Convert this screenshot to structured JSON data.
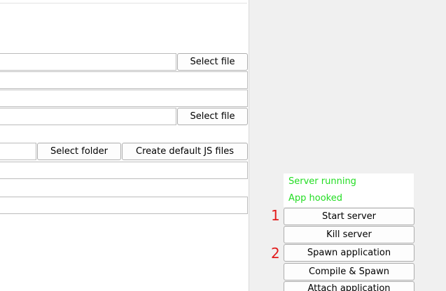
{
  "config": {
    "file_field_1": {
      "value": "",
      "button_label": "Select file"
    },
    "field_2": {
      "value": ""
    },
    "field_3": {
      "value": ""
    },
    "file_field_4": {
      "value": "",
      "button_label": "Select file"
    },
    "folder_field": {
      "value": "",
      "select_folder_label": "Select folder",
      "create_js_label": "Create default JS files"
    },
    "field_6": {
      "value": ""
    },
    "field_7": {
      "value": ""
    }
  },
  "status": {
    "server": "Server running",
    "app": "App hooked",
    "color": "#22dd22"
  },
  "actions": {
    "start_server": {
      "step": "1",
      "label": "Start server"
    },
    "kill_server": {
      "label": "Kill server"
    },
    "spawn_application": {
      "step": "2",
      "label": "Spawn application"
    },
    "compile_spawn": {
      "label": "Compile & Spawn"
    },
    "attach_application": {
      "label": "Attach application"
    }
  },
  "colors": {
    "step_number": "#e21b1b",
    "panel_background": "#f0f0f0"
  }
}
